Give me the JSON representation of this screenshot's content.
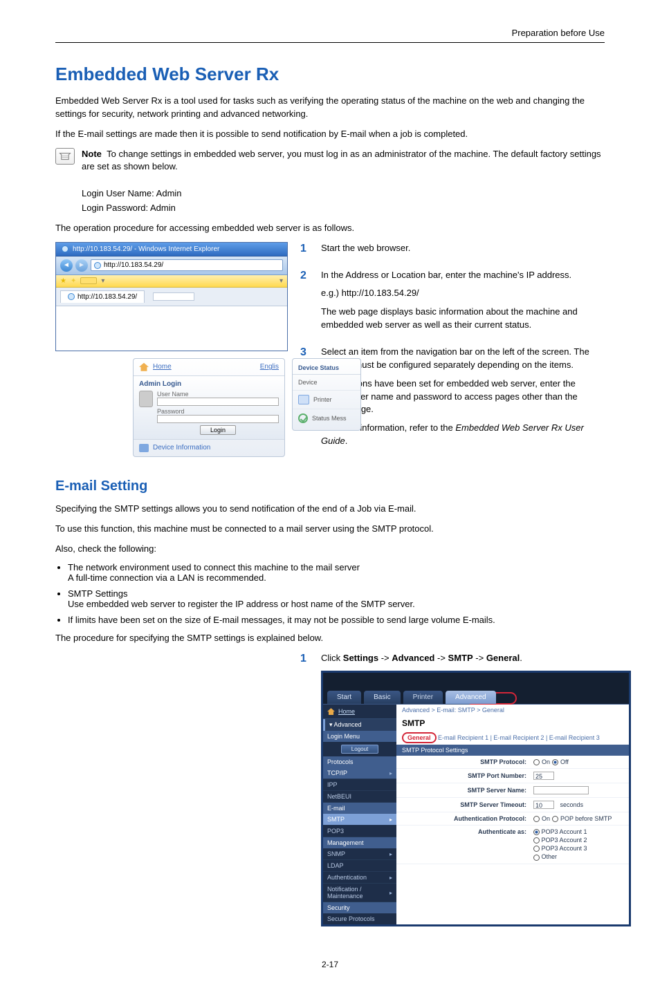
{
  "page": {
    "header_right": "Preparation before Use",
    "footer": "2-17"
  },
  "section1": {
    "title": "Embedded Web Server Rx",
    "p1": "Embedded Web Server Rx is a tool used for tasks such as verifying the operating status of the machine on the web and changing the settings for security, network printing and advanced networking.",
    "p2": "If the E-mail settings are made then it is possible to send notification by E-mail when a job is completed.",
    "note_label": "Note",
    "note_text": "To change settings in embedded web server, you must log in as an administrator of the machine. The default factory settings are set as shown below.",
    "login_user": "Login User Name: Admin",
    "login_pass": "Login Password: Admin",
    "p3": "The operation procedure for accessing embedded web server is as follows."
  },
  "browser_shot": {
    "title": "http://10.183.54.29/ - Windows Internet Explorer",
    "address": "http://10.183.54.29/",
    "tab_url": "http://10.183.54.29/"
  },
  "ews_panel": {
    "home": "Home",
    "lang": "Englis",
    "admin_login": "Admin Login",
    "user_name": "User Name",
    "password": "Password",
    "login_btn": "Login",
    "device_info": "Device Information",
    "right_head": "Device Status",
    "right_device": "Device",
    "right_printer": "Printer",
    "right_status": "Status Mess"
  },
  "steps_a": {
    "s1": "Start the web browser.",
    "s2a": "In the Address or Location bar, enter the machine's IP address.",
    "s2b": "e.g.) http://10.183.54.29/",
    "s2c": "The web page displays basic information about the machine and embedded web server as well as their current status.",
    "s3a": "Select an item from the navigation bar on the left of the screen. The settings must be configured separately depending on the items.",
    "s3b": "If restrictions have been set for embedded web server, enter the correct user name and password to access pages other than the startup page.",
    "s3c_pre": "For more information, refer to the ",
    "s3c_em": "Embedded Web Server Rx User Guide",
    "s3c_post": "."
  },
  "section2": {
    "title": "E-mail Setting",
    "p1": "Specifying the SMTP settings allows you to send notification of the end of a Job via E-mail.",
    "p2": "To use this function, this machine must be connected to a mail server using the SMTP protocol.",
    "p3": "Also, check the following:",
    "b1a": "The network environment used to connect this machine to the mail server",
    "b1b": "A full-time connection via a LAN is recommended.",
    "b2a": "SMTP Settings",
    "b2b": "Use embedded web server to register the IP address or host name of the SMTP server.",
    "b3": "If limits have been set on the size of E-mail messages, it may not be possible to send large volume E-mails.",
    "p4": "The procedure for specifying the SMTP settings is explained below.",
    "step1_pre": "Click ",
    "step1_s": "Settings",
    "step1_a": "Advanced",
    "step1_m": "SMTP",
    "step1_g": "General",
    "step1_post": "."
  },
  "smtp_shot": {
    "tab_start": "Start",
    "tab_basic": "Basic",
    "tab_printer": "Printer",
    "tab_advanced": "Advanced",
    "home": "Home",
    "breadcrumb": "Advanced > E-mail: SMTP > General",
    "left_adv": "Advanced",
    "left_login": "Login Menu",
    "logout": "Logout",
    "left_protocols": "Protocols",
    "left_tcpip": "TCP/IP",
    "left_ipp": "IPP",
    "left_netbeui": "NetBEUI",
    "left_email": "E-mail",
    "left_smtp": "SMTP",
    "left_pop3": "POP3",
    "left_mgmt": "Management",
    "left_snmp": "SNMP",
    "left_ldap": "LDAP",
    "left_auth": "Authentication",
    "left_notif": "Notification / Maintenance",
    "left_security": "Security",
    "left_secprot": "Secure Protocols",
    "right_title": "SMTP",
    "subtab_general": "General",
    "subtab_others": "E-mail Recipient 1  |  E-mail Recipient 2  |  E-mail Recipient 3",
    "settings_head": "SMTP Protocol Settings",
    "f_protocol": "SMTP Protocol:",
    "on": "On",
    "off": "Off",
    "f_port": "SMTP Port Number:",
    "v_port": "25",
    "f_server": "SMTP Server Name:",
    "f_timeout": "SMTP Server Timeout:",
    "v_timeout": "10",
    "v_seconds": "seconds",
    "f_authproto": "Authentication Protocol:",
    "v_pop_before": "POP before SMTP",
    "f_authas": "Authenticate as:",
    "v_pop1": "POP3 Account 1",
    "v_pop2": "POP3 Account 2",
    "v_pop3": "POP3 Account 3",
    "v_other": "Other"
  }
}
